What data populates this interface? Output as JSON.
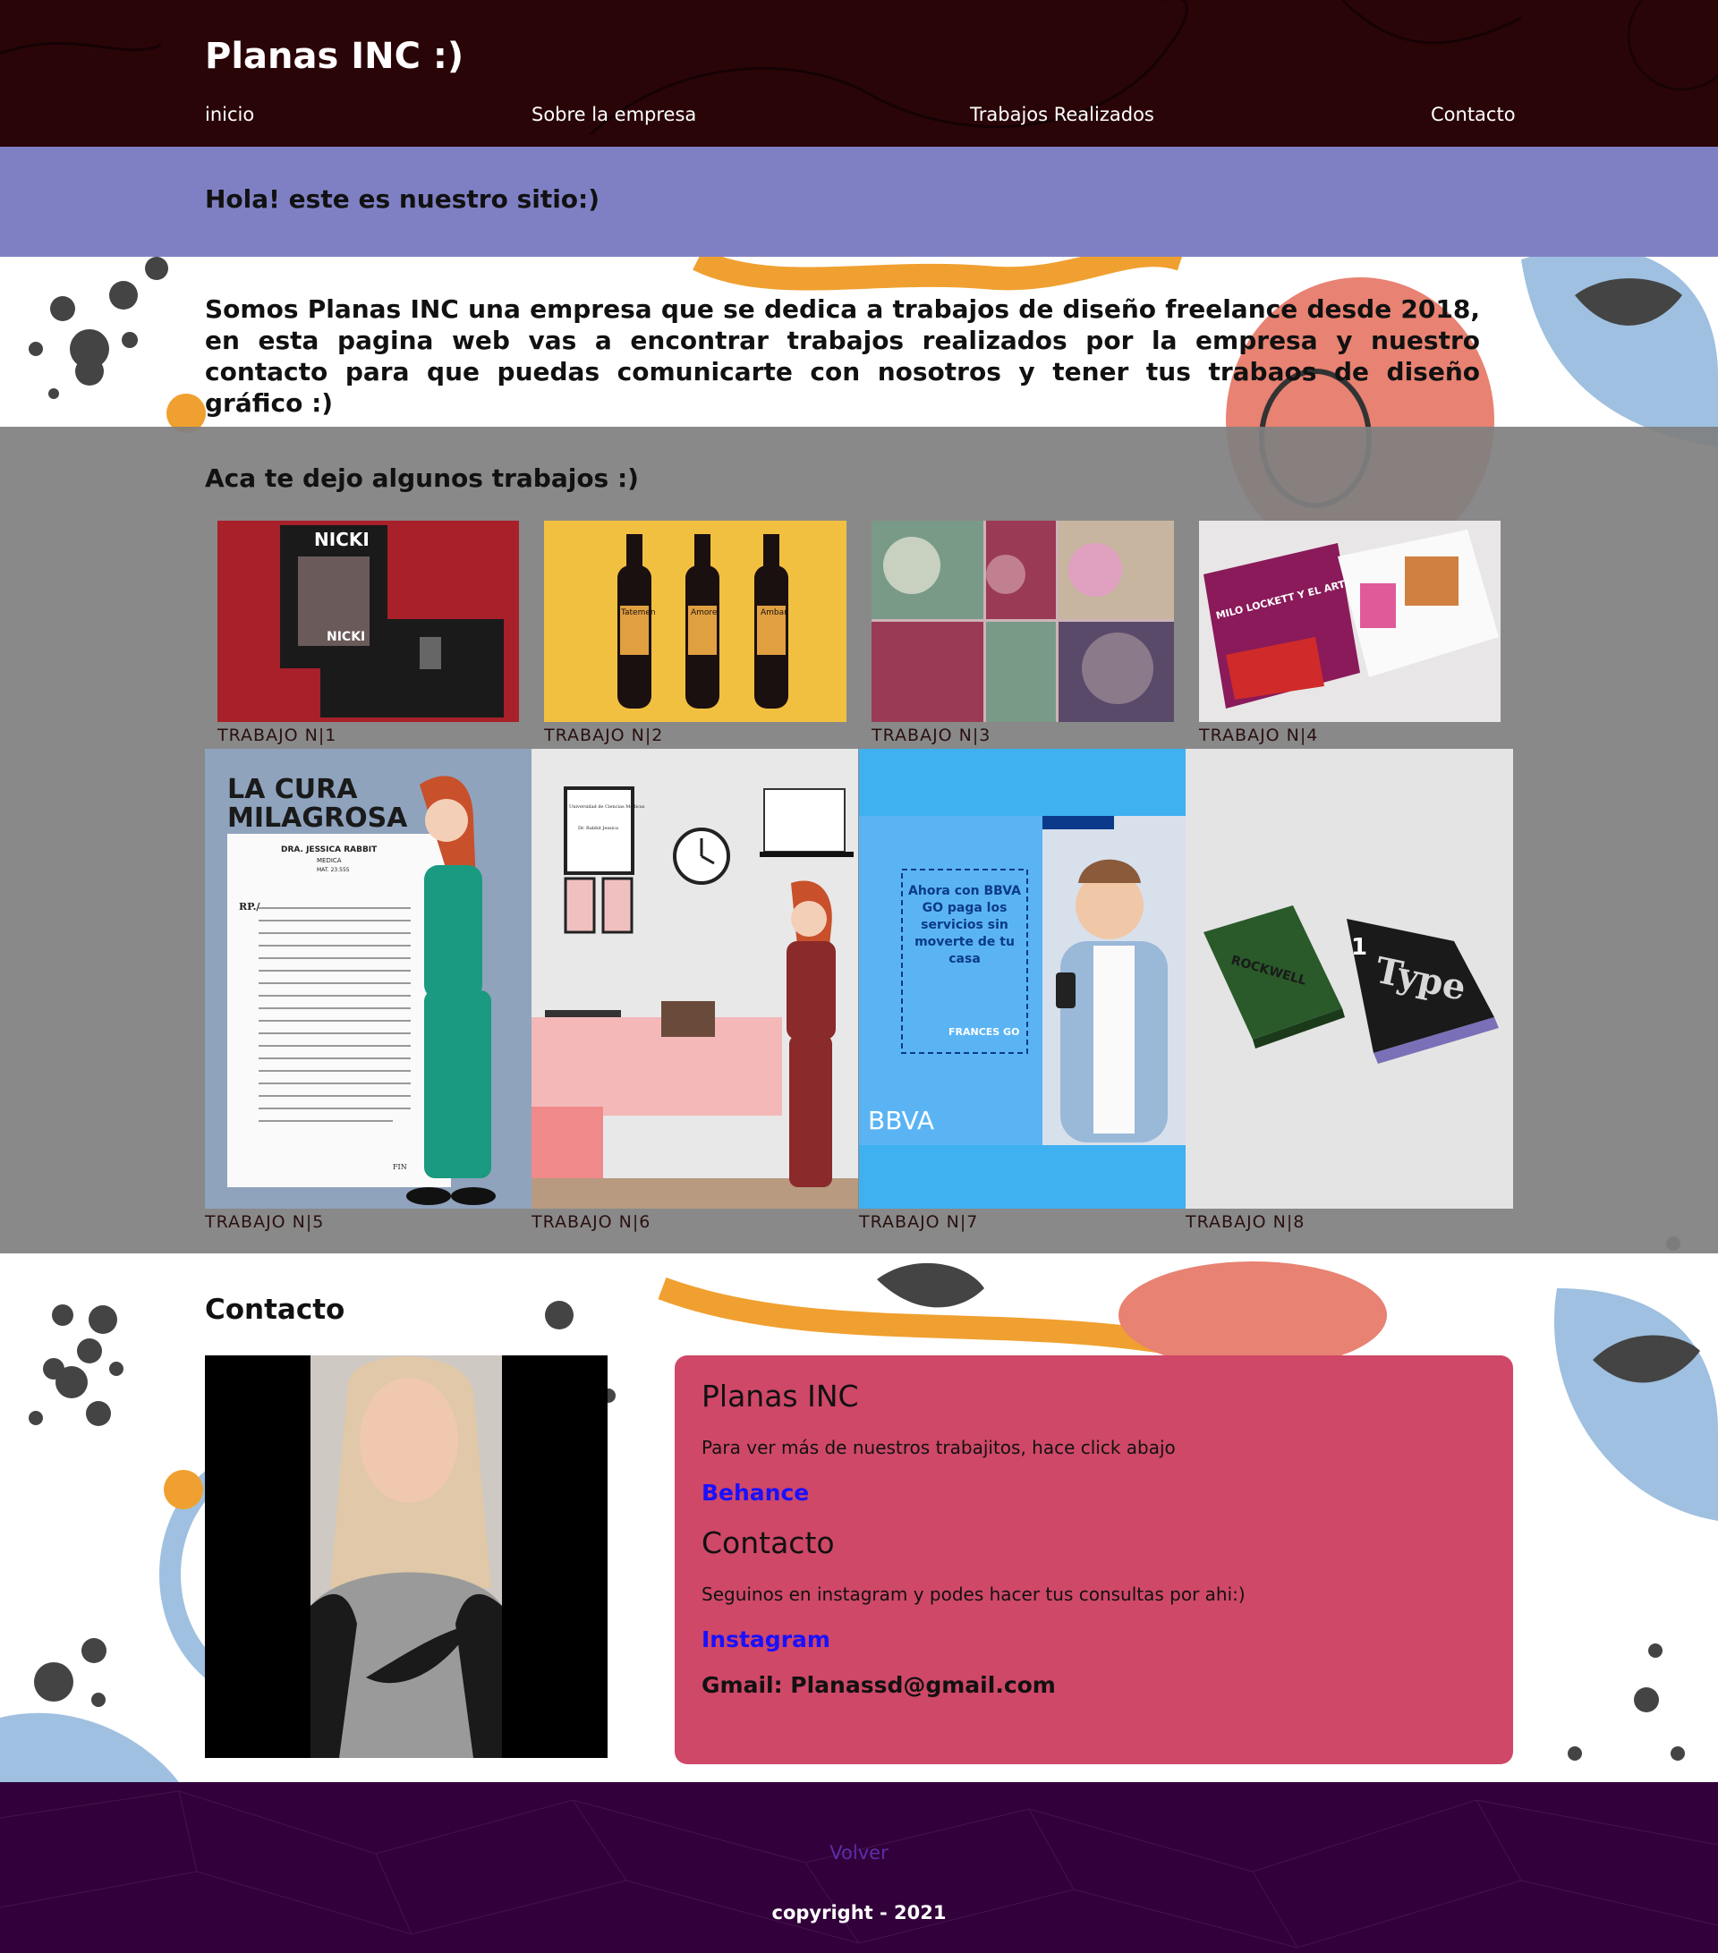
{
  "header": {
    "brand": "Planas INC :)",
    "nav": [
      "inicio",
      "Sobre la empresa",
      "Trabajos Realizados",
      "Contacto"
    ]
  },
  "hero": {
    "title": "Hola! este es nuestro sitio:)"
  },
  "intro": "Somos Planas INC una empresa que se dedica a trabajos de diseño freelance desde 2018, en esta pagina web vas a encontrar trabajos realizados por la empresa y nuestro contacto para que puedas comunicarte con nosotros y tener tus trabaos de diseño gráfico :)",
  "works": {
    "title": "Aca te dejo algunos trabajos :)",
    "items": [
      {
        "caption": "TRABAJO N|1",
        "thumb_texts": [
          "NICKI"
        ]
      },
      {
        "caption": "TRABAJO N|2",
        "thumb_texts": [
          "Tatemen",
          "Amore",
          "Ambar"
        ]
      },
      {
        "caption": "TRABAJO N|3",
        "thumb_texts": []
      },
      {
        "caption": "TRABAJO N|4",
        "thumb_texts": [
          "MILO LOCKETT Y EL ARTE"
        ]
      },
      {
        "caption": "TRABAJO N|5",
        "thumb_texts": [
          "LA CURA MILAGROSA",
          "DRA. JESSICA RABBIT",
          "MEDICA",
          "MAT. 23.555",
          "RP./",
          "FIN"
        ]
      },
      {
        "caption": "TRABAJO N|6",
        "thumb_texts": [
          "Universidad de Ciencias Médicas",
          "Dr. Rabbit Jessica"
        ]
      },
      {
        "caption": "TRABAJO N|7",
        "thumb_texts": [
          "Ahora con BBVA GO paga los servicios sin moverte de tu casa",
          "FRANCES GO",
          "BBVA"
        ]
      },
      {
        "caption": "TRABAJO N|8",
        "thumb_texts": [
          "ROCKWELL",
          "Type",
          "1"
        ]
      }
    ]
  },
  "contact": {
    "title": "Contacto",
    "card": {
      "heading1": "Planas INC",
      "text1": "Para ver más de nuestros trabajitos, hace click abajo",
      "link1": "Behance",
      "heading2": "Contacto",
      "text2": "Seguinos en instagram y podes hacer tus consultas por ahi:)",
      "link2": "Instagram",
      "gmail": "Gmail: Planassd@gmail.com"
    }
  },
  "footer": {
    "back": "Volver",
    "copyright": "copyright - 2021"
  },
  "colors": {
    "header_bg": "#2a0508",
    "hero_bg": "#7f80c4",
    "card_bg": "#cf4868",
    "footer_bg": "#32003a",
    "link": "#1a10ff"
  }
}
